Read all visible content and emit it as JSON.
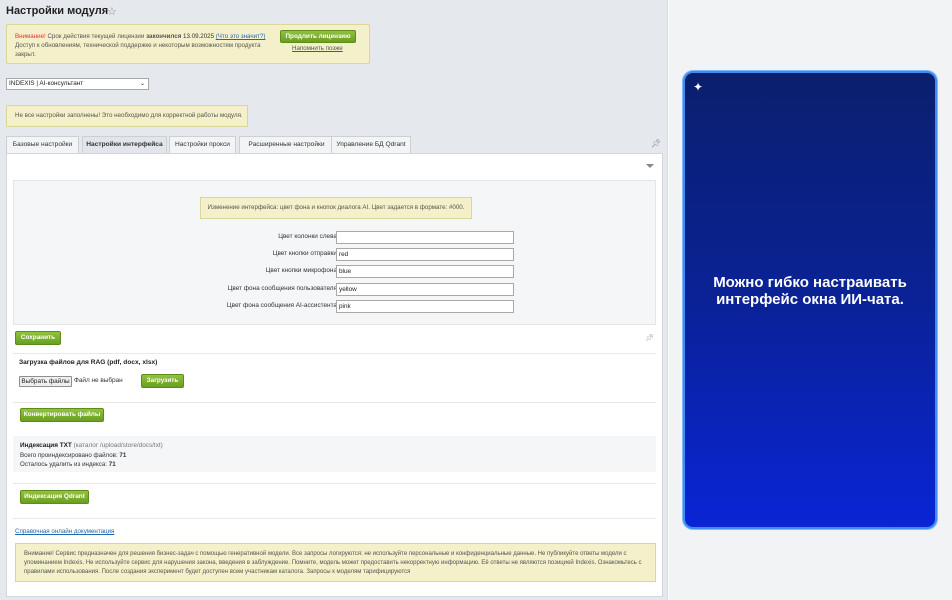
{
  "header": {
    "title": "Настройки модуля",
    "star_icon": "☆"
  },
  "license": {
    "warning": "Внимание!",
    "text_before_date": " Срок действия текущей лицензии ",
    "expired": "закончился",
    "date": " 13.09.2025",
    "what_link": "(Что это значит?)",
    "text_second": "Доступ к обновлениям, технической поддержке и некоторым возможностям продукта закрыт.",
    "renew_button": "Продлить лицензию",
    "remind_link": "Напомнить позже"
  },
  "module_select": {
    "value": "INDEXIS | AI-консультант",
    "arrow": "⌄"
  },
  "notice_not_filled": "Не все настройки заполнены! Это необходимо для корректной работы модуля.",
  "tabs": [
    {
      "label": "Базовые настройки"
    },
    {
      "label": "Настройки интерфейса"
    },
    {
      "label": "Настройки прокси"
    },
    {
      "label": "Расширенные настройки"
    },
    {
      "label": "Управление БД Qdrant"
    }
  ],
  "interface": {
    "info": "Изменение интерфейса: цвет фона и кнопок диалога AI. Цвет задается в формате: #000.",
    "fields": [
      {
        "label": "Цвет колонки слева",
        "value": ""
      },
      {
        "label": "Цвет кнопки отправки",
        "value": "red"
      },
      {
        "label": "Цвет кнопки микрофона",
        "value": "blue"
      },
      {
        "label": "Цвет фона сообщения пользователя",
        "value": "yellow"
      },
      {
        "label": "Цвет фона сообщения AI-ассистента",
        "value": "pink"
      }
    ]
  },
  "actions": {
    "save": "Сохранить",
    "rag_title": "Загрузка файлов для RAG (pdf, docx, xlsx)",
    "choose_file": "Выбрать файлы",
    "no_file": "Файл не выбран",
    "upload": "Загрузить",
    "convert": "Конвертировать файлы",
    "qdrant": "Индексация Qdrant"
  },
  "indexing": {
    "title": "Индексация TXT",
    "path": " (каталог /upload/store/docs/txt)",
    "indexed_label": "Всего проиндексировано файлов: ",
    "indexed_value": "71",
    "remove_label": "Осталось удалить из индекса: ",
    "remove_value": "71"
  },
  "docs_link": "Справочная онлайн документация",
  "disclaimer": "Внимание! Сервис предназначен для решения бизнес-задач с помощью генеративной модели. Все запросы логируются: не используйте персональные и конфиденциальные данные. Не публикуйте ответы модели с упоминанием Indexis. Не используйте сервис для нарушения закона, введения в заблуждение. Помните, модель может предоставить некорректную информацию. Её ответы не являются позицией Indexis. Ознакомьтесь с правилами использования. После создания эксперимент будет доступен всем участникам каталога. Запросы к моделям тарифицируются",
  "promo": {
    "spark_icon": "✦",
    "text": "Можно гибко настраивать интерфейс окна ИИ-чата."
  }
}
